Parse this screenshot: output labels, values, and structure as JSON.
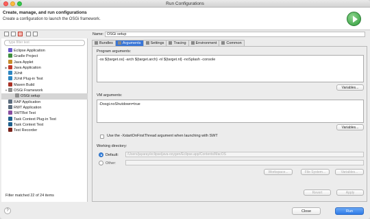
{
  "window": {
    "title": "Run Configurations"
  },
  "header": {
    "title": "Create, manage, and run configurations",
    "subtitle": "Create a configuration to launch the OSGi framework."
  },
  "sidebar": {
    "filter_placeholder": "type filter text",
    "items": [
      {
        "label": "Eclipse Application",
        "color": "#6a5acd",
        "expandable": false,
        "indent": 0
      },
      {
        "label": "Gradle Project",
        "color": "#3f8f3f",
        "expandable": false,
        "indent": 0
      },
      {
        "label": "Java Applet",
        "color": "#c78d2c",
        "expandable": false,
        "indent": 0
      },
      {
        "label": "Java Application",
        "color": "#c0392b",
        "expandable": true,
        "indent": 0
      },
      {
        "label": "JUnit",
        "color": "#2e86c1",
        "expandable": false,
        "indent": 0
      },
      {
        "label": "JUnit Plug-in Test",
        "color": "#2e86c1",
        "expandable": false,
        "indent": 0
      },
      {
        "label": "Maven Build",
        "color": "#a93226",
        "expandable": false,
        "indent": 0
      },
      {
        "label": "OSGi Framework",
        "color": "#8e8e8e",
        "expandable": true,
        "expanded": true,
        "indent": 0
      },
      {
        "label": "OSGi setup",
        "color": "#8e8e8e",
        "expandable": false,
        "indent": 1,
        "selected": true
      },
      {
        "label": "RAP Application",
        "color": "#5d6d7e",
        "expandable": false,
        "indent": 0
      },
      {
        "label": "RWT Application",
        "color": "#5d6d7e",
        "expandable": false,
        "indent": 0
      },
      {
        "label": "SWTBot Test",
        "color": "#884ea0",
        "expandable": false,
        "indent": 0
      },
      {
        "label": "Task Context Plug-in Test",
        "color": "#1f618d",
        "expandable": false,
        "indent": 0
      },
      {
        "label": "Task Context Test",
        "color": "#1f618d",
        "expandable": false,
        "indent": 0
      },
      {
        "label": "Test Recorder",
        "color": "#7b241c",
        "expandable": false,
        "indent": 0
      }
    ],
    "status": "Filter matched 22 of 24 items"
  },
  "config": {
    "name_label": "Name:",
    "name_value": "OSGi setup",
    "tabs": [
      "Bundles",
      "Arguments",
      "Settings",
      "Tracing",
      "Environment",
      "Common"
    ],
    "active_tab": "Arguments",
    "program_args_label": "Program arguments:",
    "program_args_value": "-os ${target.os} -arch ${target.arch} -nl ${target.nl} -noSplash -console",
    "variables_label": "Variables...",
    "vm_args_label": "VM arguments:",
    "vm_args_value": "-Dosgi.noShutdown=true",
    "xstart_label": "Use the -XstartOnFirstThread argument when launching with SWT",
    "working_dir_label": "Working directory:",
    "default_label": "Default:",
    "default_value": "/Users/jayaray/eclipse/java-oxygen/Eclipse.app/Contents/MacOS",
    "other_label": "Other:",
    "workspace_btn": "Workspace...",
    "filesystem_btn": "File System...",
    "variables2_btn": "Variables..."
  },
  "actions": {
    "revert": "Revert",
    "apply": "Apply",
    "close": "Close",
    "run": "Run",
    "help": "?"
  }
}
